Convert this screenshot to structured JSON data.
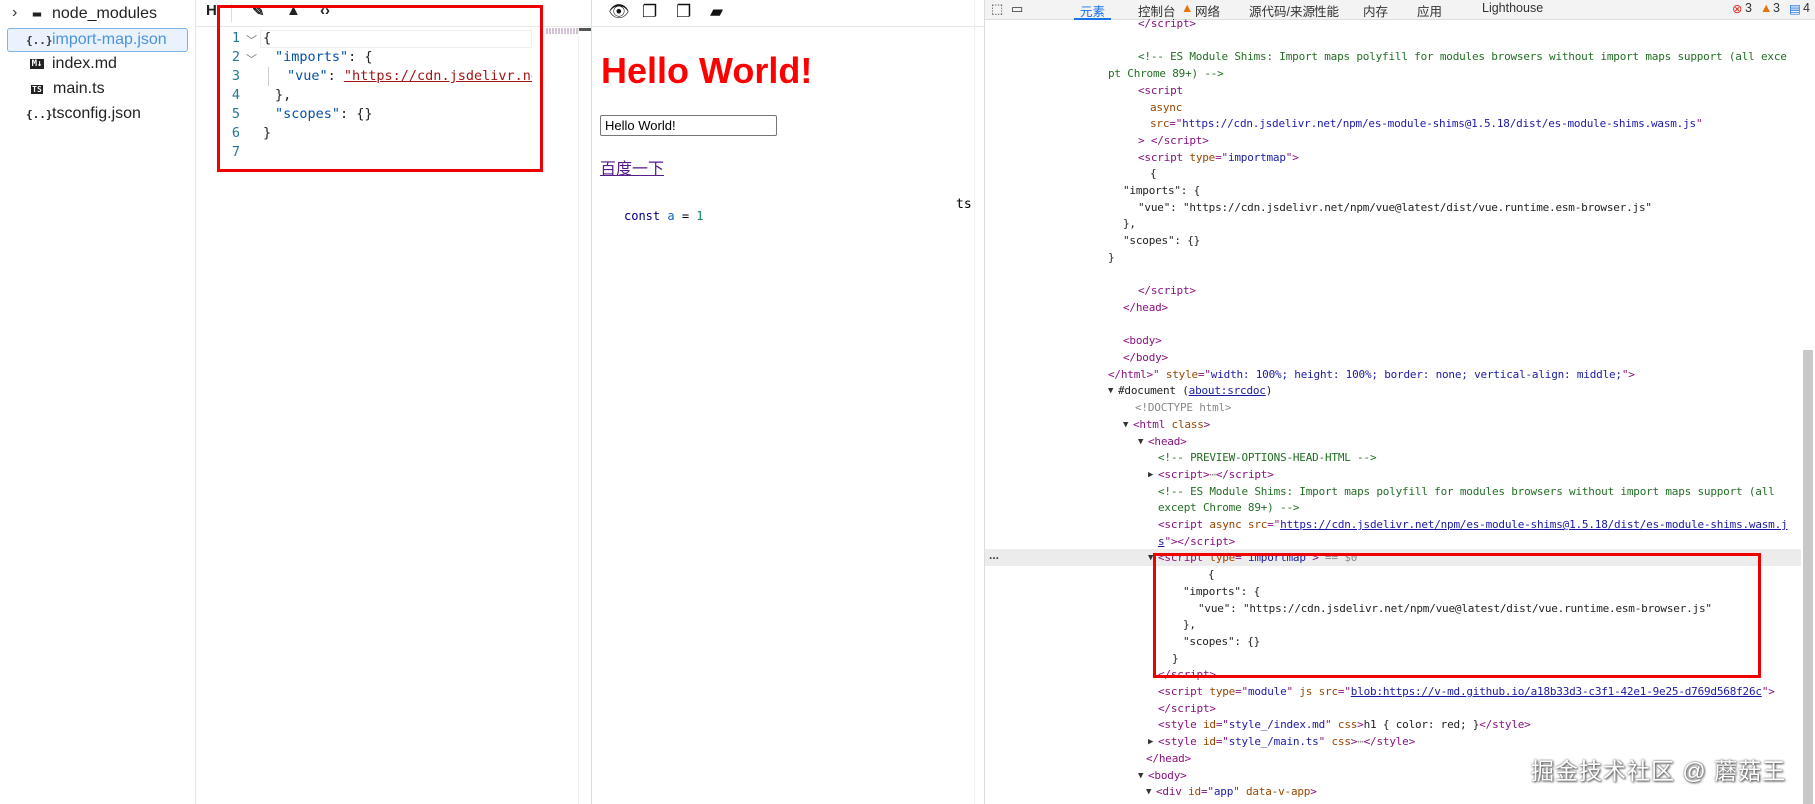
{
  "file_tree": {
    "items": [
      {
        "label": "node_modules",
        "icon": "folder-icon",
        "glyph": "▬"
      },
      {
        "label": "import-map.json",
        "icon": "json-file-icon",
        "glyph": "{..}",
        "selected": true
      },
      {
        "label": "index.md",
        "icon": "markdown-file-icon",
        "glyph": "M↓"
      },
      {
        "label": "main.ts",
        "icon": "typescript-file-icon",
        "glyph": "TS"
      },
      {
        "label": "tsconfig.json",
        "icon": "json-file-icon",
        "glyph": "{..}"
      }
    ],
    "expand_glyph": "›"
  },
  "editor": {
    "toolbar": {
      "heading": "H",
      "wand": "✎",
      "shapes": "▲",
      "code": "‹›"
    },
    "line_numbers": [
      "1",
      "2",
      "3",
      "4",
      "5",
      "6",
      "7"
    ],
    "lines": {
      "l1": "{",
      "l2_key": "\"imports\"",
      "l2_rest": ": {",
      "l3_key": "\"vue\"",
      "l3_sep": ": ",
      "l3_val": "\"https://cdn.jsdelivr.net",
      "l4": "},",
      "l5_key": "\"scopes\"",
      "l5_rest": ": {}",
      "l6": "}"
    }
  },
  "preview": {
    "toolbar": {
      "eye": "👁",
      "copy1": "❐",
      "copy2": "❐",
      "folder": "▰"
    },
    "heading": "Hello World!",
    "input_value": "Hello World!",
    "link": "百度一下",
    "code": {
      "kw": "const",
      "var": "a",
      "eq": " = ",
      "num": "1"
    },
    "code_lang": "ts"
  },
  "devtools": {
    "tabs": [
      "元素",
      "控制台",
      "网络",
      "源代码/来源",
      "性能",
      "内存",
      "应用",
      "Lighthouse"
    ],
    "active_tab": "元素",
    "counts": {
      "errors": "3",
      "warnings": "3",
      "info": "4"
    },
    "selected_marker": "...",
    "lines": [
      [
        [
          "t",
          "</script>"
        ]
      ],
      [],
      [
        [
          "c",
          "<!-- ES Module Shims: Import maps polyfill for modules browsers without import maps support (all exce"
        ]
      ],
      [
        [
          "c",
          "pt Chrome 89+) -->"
        ]
      ],
      [
        [
          "t",
          "<script"
        ]
      ],
      [
        [
          "an",
          "async"
        ]
      ],
      [
        [
          "an",
          "src"
        ],
        [
          "t",
          "=\""
        ],
        [
          "av",
          "https://cdn.jsdelivr.net/npm/es-module-shims@1.5.18/dist/es-module-shims.wasm.js"
        ],
        [
          "t",
          "\""
        ]
      ],
      [
        [
          "t",
          "> </script>"
        ]
      ],
      [
        [
          "t",
          "<script "
        ],
        [
          "an",
          "type"
        ],
        [
          "t",
          "=\""
        ],
        [
          "av",
          "importmap"
        ],
        [
          "t",
          "\">"
        ]
      ],
      [
        [
          "p",
          "{"
        ]
      ],
      [
        [
          "p",
          "\"imports\": {"
        ]
      ],
      [
        [
          "p",
          "\"vue\": \"https://cdn.jsdelivr.net/npm/vue@latest/dist/vue.runtime.esm-browser.js\""
        ]
      ],
      [
        [
          "p",
          "},"
        ]
      ],
      [
        [
          "p",
          "\"scopes\": {}"
        ]
      ],
      [
        [
          "p",
          "}"
        ]
      ],
      [],
      [
        [
          "t",
          "</script>"
        ]
      ],
      [
        [
          "t",
          "</head>"
        ]
      ],
      [],
      [
        [
          "t",
          "<body>"
        ]
      ],
      [
        [
          "t",
          "</body>"
        ]
      ],
      [
        [
          "t",
          "</html>\" "
        ],
        [
          "an",
          "style"
        ],
        [
          "t",
          "=\""
        ],
        [
          "av",
          "width: 100%; height: 100%; border: none; vertical-align: middle;"
        ],
        [
          "t",
          "\">"
        ]
      ],
      [
        [
          "p",
          "#document ("
        ],
        [
          "l",
          "about:srcdoc"
        ],
        [
          "p",
          ")"
        ]
      ],
      [
        [
          "g",
          "<!DOCTYPE html>"
        ]
      ],
      [
        [
          "t",
          "<html "
        ],
        [
          "an",
          "class"
        ],
        [
          "t",
          ">"
        ]
      ],
      [
        [
          "t",
          "<head>"
        ]
      ],
      [
        [
          "c",
          "<!-- PREVIEW-OPTIONS-HEAD-HTML -->"
        ]
      ],
      [
        [
          "t",
          "<script>"
        ],
        [
          "g",
          "⋯"
        ],
        [
          "t",
          "</script>"
        ]
      ],
      [
        [
          "c",
          "<!-- ES Module Shims: Import maps polyfill for modules browsers without import maps support (all"
        ]
      ],
      [
        [
          "c",
          "except Chrome 89+) -->"
        ]
      ],
      [
        [
          "t",
          "<script "
        ],
        [
          "an",
          "async src"
        ],
        [
          "t",
          "=\""
        ],
        [
          "l",
          "https://cdn.jsdelivr.net/npm/es-module-shims@1.5.18/dist/es-module-shims.wasm.j"
        ]
      ],
      [
        [
          "l",
          "s"
        ],
        [
          "t",
          "\"></script>"
        ]
      ],
      [
        [
          "t",
          "<script "
        ],
        [
          "an",
          "type"
        ],
        [
          "t",
          "=\""
        ],
        [
          "av",
          "importmap"
        ],
        [
          "t",
          "\">"
        ],
        [
          "g",
          " == $0"
        ]
      ],
      [
        [
          "p",
          "{"
        ]
      ],
      [
        [
          "p",
          "\"imports\": {"
        ]
      ],
      [
        [
          "p",
          "\"vue\": \"https://cdn.jsdelivr.net/npm/vue@latest/dist/vue.runtime.esm-browser.js\""
        ]
      ],
      [
        [
          "p",
          "},"
        ]
      ],
      [
        [
          "p",
          "\"scopes\": {}"
        ]
      ],
      [
        [
          "p",
          "}"
        ]
      ],
      [
        [
          "t",
          "</script>"
        ]
      ],
      [
        [
          "t",
          "<script "
        ],
        [
          "an",
          "type"
        ],
        [
          "t",
          "=\""
        ],
        [
          "av",
          "module"
        ],
        [
          "t",
          "\" "
        ],
        [
          "an",
          "js src"
        ],
        [
          "t",
          "=\""
        ],
        [
          "l",
          "blob:https://v-md.github.io/a18b33d3-c3f1-42e1-9e25-d769d568f26c"
        ],
        [
          "t",
          "\">"
        ]
      ],
      [
        [
          "t",
          "</script>"
        ]
      ],
      [
        [
          "t",
          "<style "
        ],
        [
          "an",
          "id"
        ],
        [
          "t",
          "=\""
        ],
        [
          "av",
          "style_/index.md"
        ],
        [
          "t",
          "\" "
        ],
        [
          "an",
          "css"
        ],
        [
          "t",
          ">"
        ],
        [
          "p",
          "h1 { color: red; }"
        ],
        [
          "t",
          "</style>"
        ]
      ],
      [
        [
          "t",
          "<style "
        ],
        [
          "an",
          "id"
        ],
        [
          "t",
          "=\""
        ],
        [
          "av",
          "style_/main.ts"
        ],
        [
          "t",
          "\" "
        ],
        [
          "an",
          "css"
        ],
        [
          "t",
          ">"
        ],
        [
          "g",
          "⋯"
        ],
        [
          "t",
          "</style>"
        ]
      ],
      [
        [
          "t",
          "</head>"
        ]
      ],
      [
        [
          "t",
          "<body>"
        ]
      ],
      [
        [
          "t",
          "<div "
        ],
        [
          "an",
          "id"
        ],
        [
          "t",
          "=\""
        ],
        [
          "av",
          "app"
        ],
        [
          "t",
          "\" "
        ],
        [
          "an",
          "data-v-app"
        ],
        [
          "t",
          ">"
        ]
      ]
    ],
    "expanders": {
      "22": "▼",
      "24": "▼",
      "25": "▼",
      "27": "▶",
      "32": "▼",
      "43": "▶",
      "45": "▼",
      "46": "▼"
    }
  },
  "watermark": "掘金技术社区 @ 蘑菇王",
  "colors": {
    "accent": "#1a73e8",
    "highlight_box": "#e00000",
    "heading": "#ff0000"
  }
}
